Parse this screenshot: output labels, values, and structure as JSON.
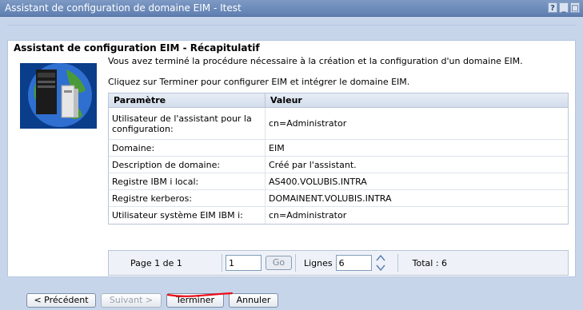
{
  "window": {
    "title": "Assistant de configuration de domaine EIM - Itest",
    "help_glyph": "?",
    "min_glyph": "_",
    "close_glyph": "□"
  },
  "page": {
    "heading": "Assistant de configuration EIM - Récapitulatif",
    "intro1": "Vous avez terminé la procédure nécessaire à la création et la configuration d'un domaine EIM.",
    "intro2": "Cliquez sur Terminer pour configurer EIM et intégrer le domaine EIM."
  },
  "table": {
    "headers": [
      "Paramètre",
      "Valeur"
    ],
    "rows": [
      {
        "param": "Utilisateur de l'assistant pour la configuration:",
        "value": "cn=Administrator"
      },
      {
        "param": "Domaine:",
        "value": "EIM"
      },
      {
        "param": "Description de domaine:",
        "value": "Créé par l'assistant."
      },
      {
        "param": "Registre IBM i local:",
        "value": "AS400.VOLUBIS.INTRA"
      },
      {
        "param": "Registre kerberos:",
        "value": "DOMAINENT.VOLUBIS.INTRA"
      },
      {
        "param": "Utilisateur système EIM IBM i:",
        "value": "cn=Administrator"
      }
    ]
  },
  "pager": {
    "page_text": "Page 1 de 1",
    "page_input": "1",
    "go_label": "Go",
    "lines_label": "Lignes",
    "lines_input": "6",
    "total_text": "Total : 6"
  },
  "buttons": {
    "previous": "< Précédent",
    "next": "Suivant >",
    "finish": "Terminer",
    "cancel": "Annuler"
  },
  "colors": {
    "titlebar": "#6b88ba",
    "frame": "#c7d5ea",
    "annotation": "#e8101a"
  }
}
